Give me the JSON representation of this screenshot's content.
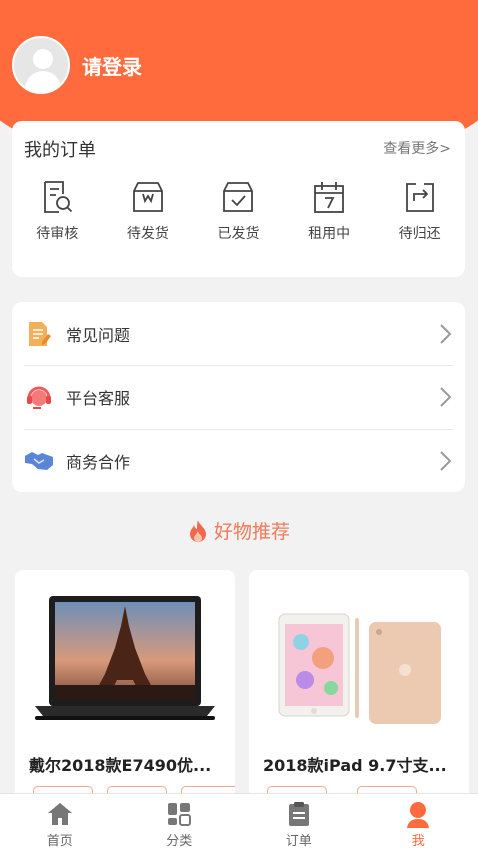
{
  "header": {
    "login_text": "请登录"
  },
  "orders": {
    "title": "我的订单",
    "more_label": "查看更多>",
    "items": [
      {
        "label": "待审核",
        "icon": "review-icon"
      },
      {
        "label": "待发货",
        "icon": "to-ship-box-icon"
      },
      {
        "label": "已发货",
        "icon": "shipped-box-icon"
      },
      {
        "label": "租用中",
        "icon": "calendar-icon"
      },
      {
        "label": "待归还",
        "icon": "return-icon"
      }
    ]
  },
  "menu": {
    "items": [
      {
        "label": "常见问题",
        "icon": "faq-document-icon"
      },
      {
        "label": "平台客服",
        "icon": "customer-service-icon"
      },
      {
        "label": "商务合作",
        "icon": "handshake-icon"
      }
    ]
  },
  "recommend": {
    "title": "好物推荐",
    "icon": "flame-icon"
  },
  "products": [
    {
      "title": "戴尔2018款E7490优...",
      "image": "laptop-image"
    },
    {
      "title": "2018款iPad 9.7寸支...",
      "image": "ipad-image"
    }
  ],
  "tabbar": {
    "items": [
      {
        "label": "首页",
        "icon": "home-icon",
        "active": false
      },
      {
        "label": "分类",
        "icon": "category-icon",
        "active": false
      },
      {
        "label": "订单",
        "icon": "clipboard-icon",
        "active": false
      },
      {
        "label": "我",
        "icon": "user-icon",
        "active": true
      }
    ]
  },
  "colors": {
    "accent": "#ff6b3d",
    "background": "#f2f2f2"
  }
}
